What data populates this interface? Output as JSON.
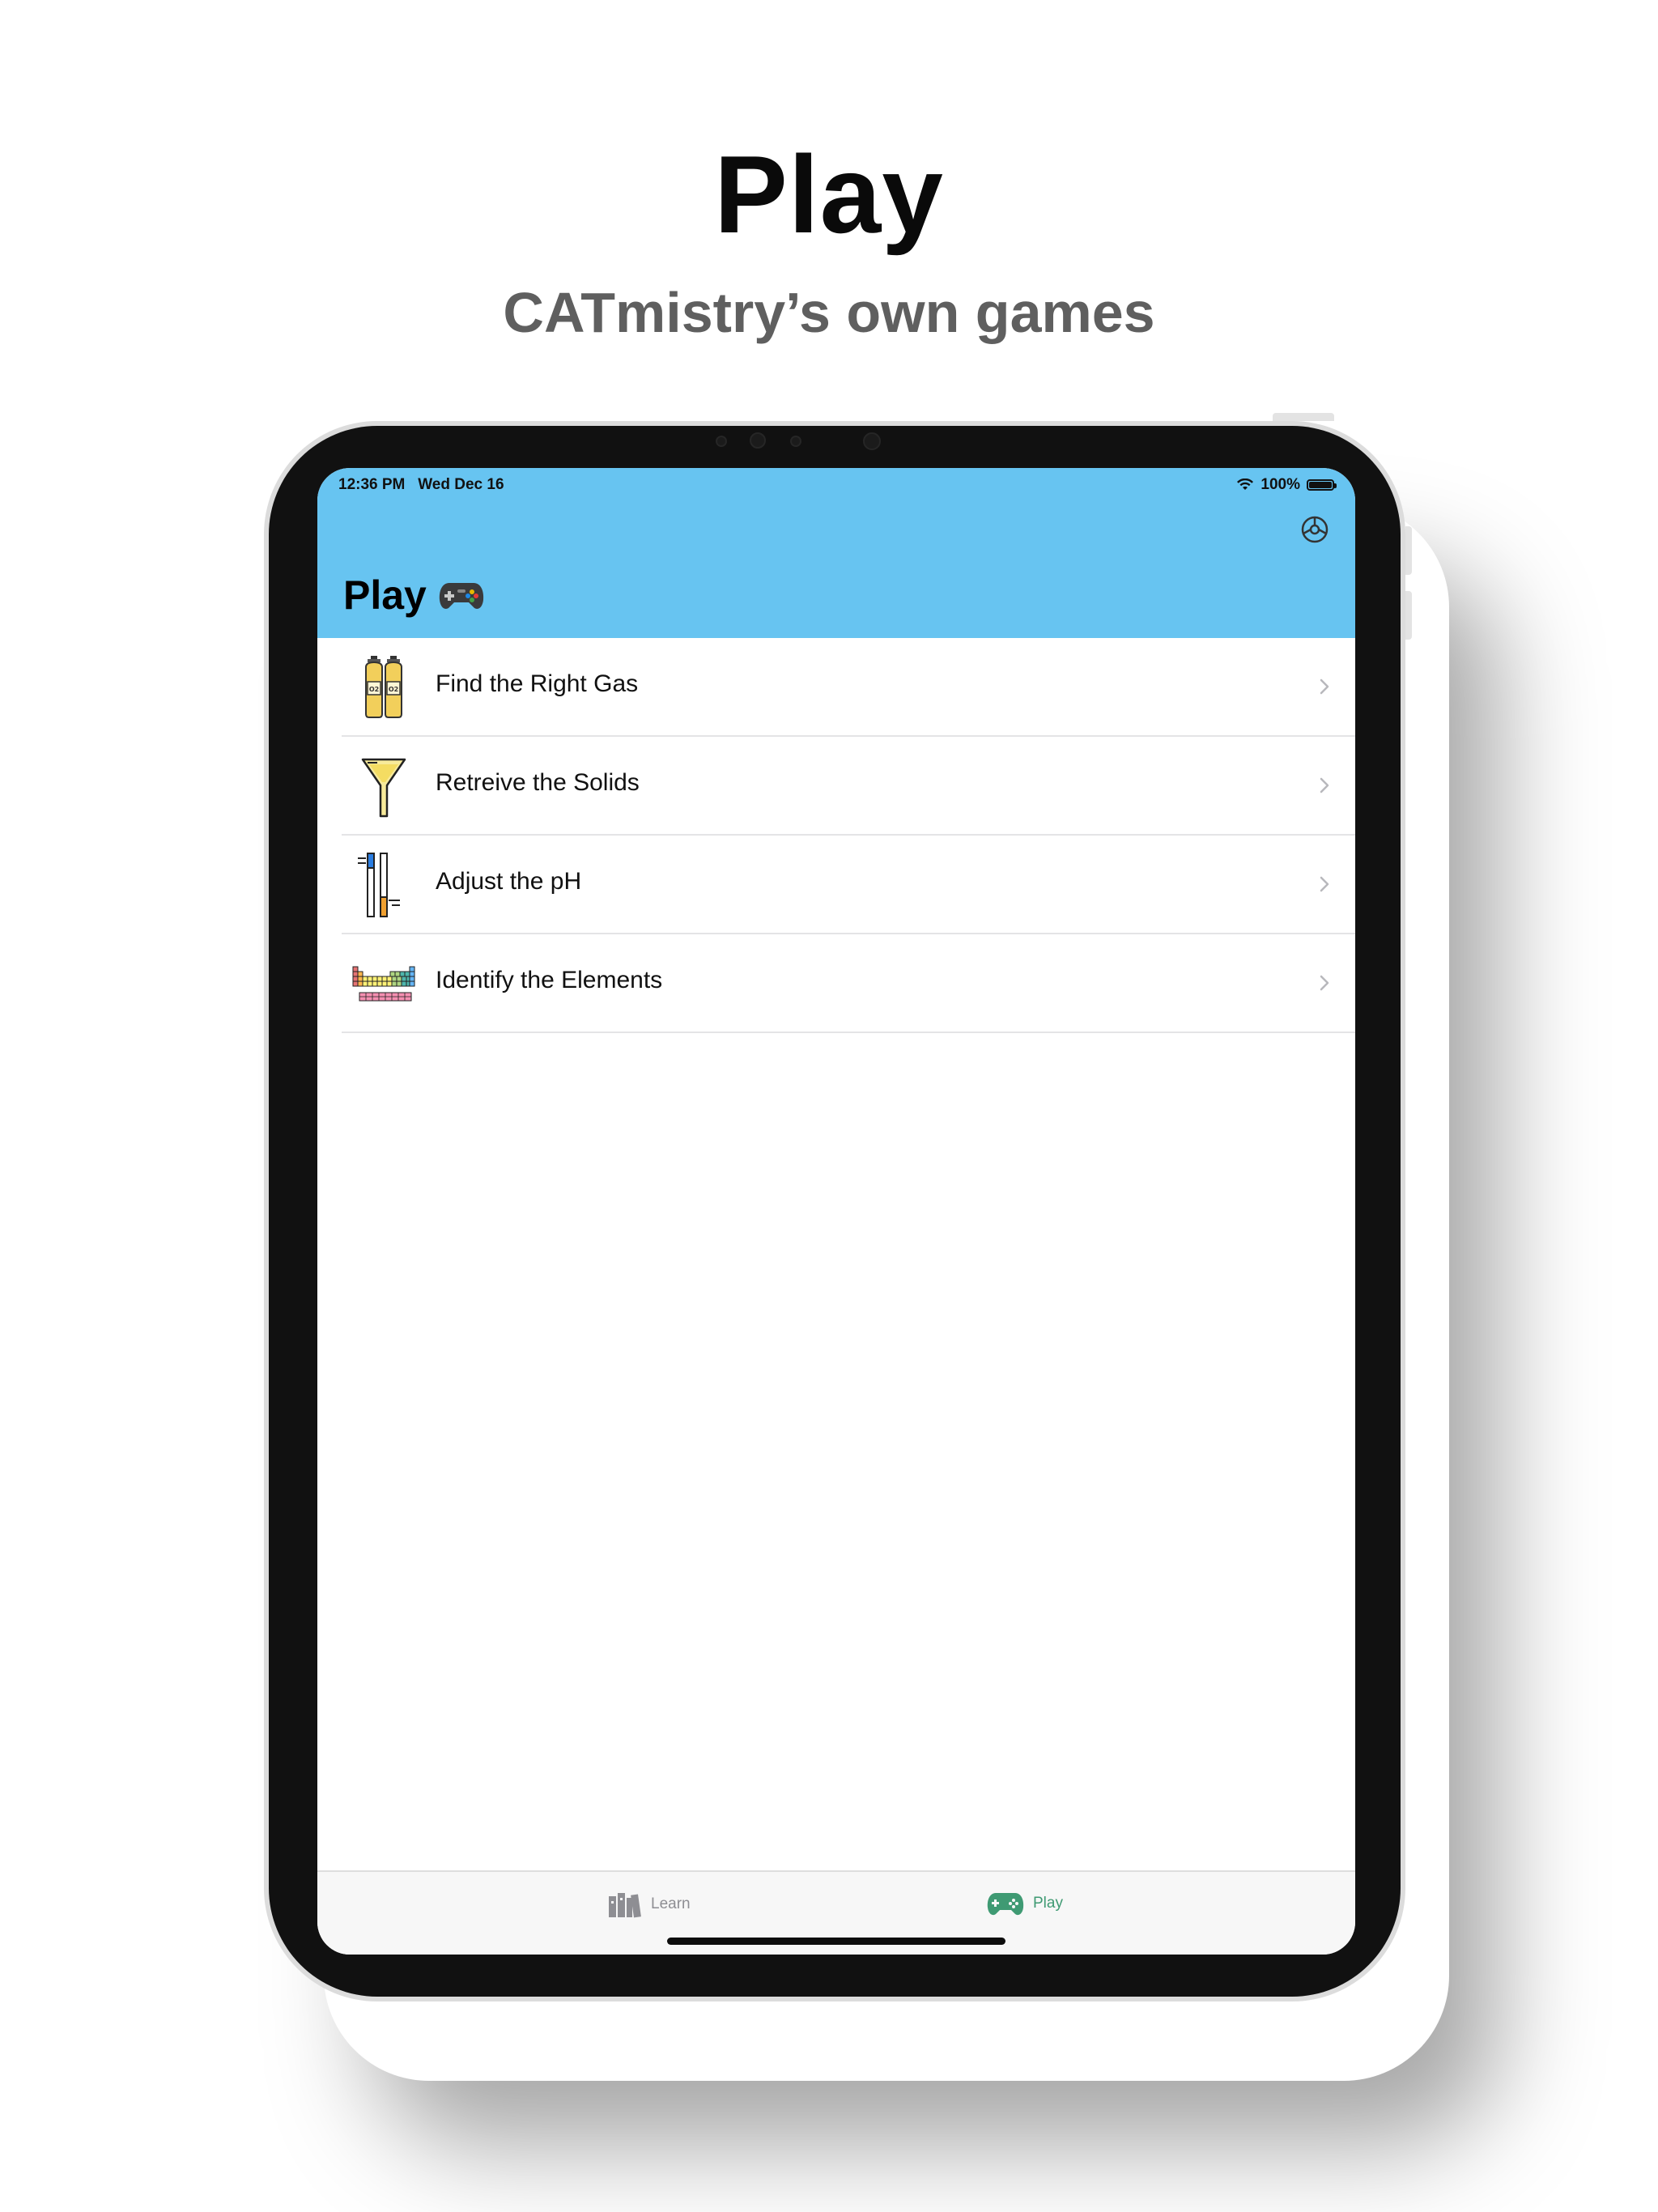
{
  "hero": {
    "title": "Play",
    "subtitle": "CATmistry’s own games"
  },
  "status_bar": {
    "time_date": "12:36 PM   Wed Dec 16",
    "battery": "100%"
  },
  "header": {
    "title": "Play",
    "title_icon": "gamepad-emoji-icon",
    "background_color": "#67c4f1",
    "settings_icon": "gear-icon"
  },
  "games": [
    {
      "label": "Find the Right Gas",
      "icon": "gas-cylinders-icon"
    },
    {
      "label": "Retreive the Solids",
      "icon": "filter-funnel-icon"
    },
    {
      "label": "Adjust the pH",
      "icon": "ph-meter-icon"
    },
    {
      "label": "Identify the Elements",
      "icon": "periodic-table-icon"
    }
  ],
  "tabbar": {
    "learn": {
      "label": "Learn",
      "icon": "books-icon",
      "color": "#8e8e93"
    },
    "play": {
      "label": "Play",
      "icon": "gamepad-icon",
      "color": "#3f9a73",
      "selected": true
    }
  }
}
